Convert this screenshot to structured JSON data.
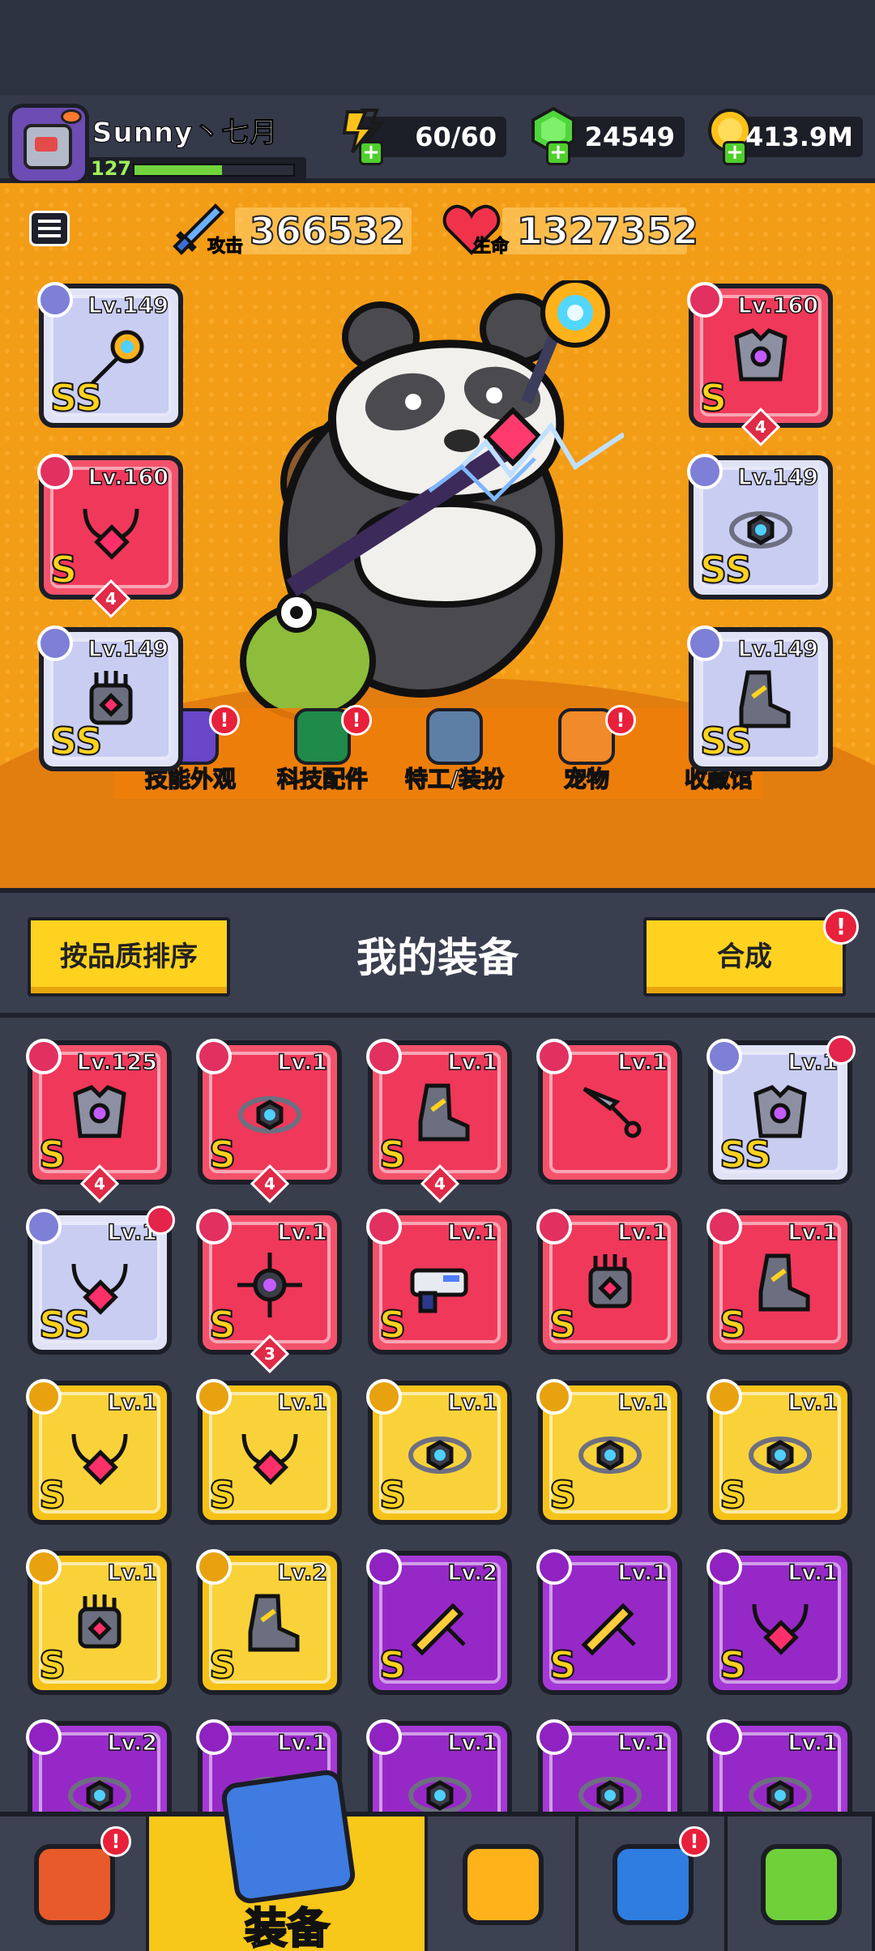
{
  "player": {
    "name": "Sunny丶七月",
    "level": "127",
    "xp_fraction": 0.55
  },
  "resources": {
    "energy": "60/60",
    "gems": "24549",
    "coins": "413.9M"
  },
  "stats": {
    "attack_value": "366532",
    "attack_label": "攻击",
    "hp_value": "1327352",
    "hp_label": "生命"
  },
  "equipped": {
    "left": [
      {
        "lv": "Lv.149",
        "color": "white",
        "rank": "SS",
        "icon": "staff-icon",
        "stars": ""
      },
      {
        "lv": "Lv.160",
        "color": "red",
        "rank": "S",
        "icon": "necklace-icon",
        "stars": "4"
      },
      {
        "lv": "Lv.149",
        "color": "white",
        "rank": "SS",
        "icon": "gauntlet-icon",
        "stars": ""
      }
    ],
    "right": [
      {
        "lv": "Lv.160",
        "color": "red",
        "rank": "S",
        "icon": "armor-icon",
        "stars": "4"
      },
      {
        "lv": "Lv.149",
        "color": "white",
        "rank": "SS",
        "icon": "belt-icon",
        "stars": ""
      },
      {
        "lv": "Lv.149",
        "color": "white",
        "rank": "SS",
        "icon": "boots-icon",
        "stars": ""
      }
    ]
  },
  "features": [
    {
      "label": "技能外观",
      "icon": "skill-skin-icon",
      "notif": "!"
    },
    {
      "label": "科技配件",
      "icon": "tech-parts-icon",
      "notif": "!"
    },
    {
      "label": "特工/装扮",
      "icon": "agent-costume-icon",
      "notif": ""
    },
    {
      "label": "宠物",
      "icon": "pet-icon",
      "notif": "!"
    },
    {
      "label": "收藏馆",
      "icon": "collection-icon",
      "notif": ""
    }
  ],
  "section": {
    "sort_label": "按品质排序",
    "title": "我的装备",
    "merge_label": "合成",
    "merge_notif": "!"
  },
  "inventory": [
    [
      {
        "lv": "Lv.125",
        "color": "red",
        "rank": "S",
        "icon": "armor-icon",
        "stars": "4",
        "shirt": false
      },
      {
        "lv": "Lv.1",
        "color": "red",
        "rank": "S",
        "icon": "belt-icon",
        "stars": "4",
        "shirt": false
      },
      {
        "lv": "Lv.1",
        "color": "red",
        "rank": "S",
        "icon": "boots-icon",
        "stars": "4",
        "shirt": false
      },
      {
        "lv": "Lv.1",
        "color": "red",
        "rank": "",
        "icon": "kunai-icon",
        "stars": "",
        "shirt": false
      },
      {
        "lv": "Lv.1",
        "color": "white",
        "rank": "SS",
        "icon": "armor-icon",
        "stars": "",
        "shirt": true
      }
    ],
    [
      {
        "lv": "Lv.1",
        "color": "white",
        "rank": "SS",
        "icon": "necklace-icon",
        "stars": "",
        "shirt": true
      },
      {
        "lv": "Lv.1",
        "color": "red",
        "rank": "S",
        "icon": "drill-icon",
        "stars": "3",
        "shirt": false
      },
      {
        "lv": "Lv.1",
        "color": "red",
        "rank": "S",
        "icon": "blaster-icon",
        "stars": "",
        "shirt": false
      },
      {
        "lv": "Lv.1",
        "color": "red",
        "rank": "S",
        "icon": "gauntlet-icon",
        "stars": "",
        "shirt": false
      },
      {
        "lv": "Lv.1",
        "color": "red",
        "rank": "S",
        "icon": "boots-icon",
        "stars": "",
        "shirt": false
      }
    ],
    [
      {
        "lv": "Lv.1",
        "color": "yellow",
        "rank": "S",
        "icon": "necklace-icon",
        "stars": "",
        "shirt": false
      },
      {
        "lv": "Lv.1",
        "color": "yellow",
        "rank": "S",
        "icon": "necklace-icon",
        "stars": "",
        "shirt": false
      },
      {
        "lv": "Lv.1",
        "color": "yellow",
        "rank": "S",
        "icon": "belt-icon",
        "stars": "",
        "shirt": false
      },
      {
        "lv": "Lv.1",
        "color": "yellow",
        "rank": "S",
        "icon": "belt-icon",
        "stars": "",
        "shirt": false
      },
      {
        "lv": "Lv.1",
        "color": "yellow",
        "rank": "S",
        "icon": "belt-icon",
        "stars": "",
        "shirt": false
      }
    ],
    [
      {
        "lv": "Lv.1",
        "color": "yellow",
        "rank": "S",
        "icon": "gauntlet-icon",
        "stars": "",
        "shirt": false
      },
      {
        "lv": "Lv.2",
        "color": "yellow",
        "rank": "S",
        "icon": "boots-icon",
        "stars": "",
        "shirt": false
      },
      {
        "lv": "Lv.2",
        "color": "purple",
        "rank": "S",
        "icon": "sword-icon",
        "stars": "",
        "shirt": false
      },
      {
        "lv": "Lv.1",
        "color": "purple",
        "rank": "S",
        "icon": "sword-icon",
        "stars": "",
        "shirt": false
      },
      {
        "lv": "Lv.1",
        "color": "purple",
        "rank": "S",
        "icon": "necklace-icon",
        "stars": "",
        "shirt": false
      }
    ],
    [
      {
        "lv": "Lv.2",
        "color": "purple",
        "rank": "",
        "icon": "belt-icon",
        "stars": "",
        "shirt": false
      },
      {
        "lv": "Lv.1",
        "color": "purple",
        "rank": "",
        "icon": "belt-icon",
        "stars": "",
        "shirt": false
      },
      {
        "lv": "Lv.1",
        "color": "purple",
        "rank": "",
        "icon": "belt-icon",
        "stars": "",
        "shirt": false
      },
      {
        "lv": "Lv.1",
        "color": "purple",
        "rank": "",
        "icon": "belt-icon",
        "stars": "",
        "shirt": false
      },
      {
        "lv": "Lv.1",
        "color": "purple",
        "rank": "",
        "icon": "belt-icon",
        "stars": "",
        "shirt": false
      }
    ]
  ],
  "bottom_nav": [
    {
      "label": "",
      "icon": "shop-icon",
      "notif": "!",
      "active": false
    },
    {
      "label": "装备",
      "icon": "equipment-icon",
      "notif": "",
      "active": true
    },
    {
      "label": "",
      "icon": "battle-icon",
      "notif": "",
      "active": false
    },
    {
      "label": "",
      "icon": "planet-icon",
      "notif": "!",
      "active": false
    },
    {
      "label": "",
      "icon": "evolve-icon",
      "notif": "",
      "active": false
    }
  ],
  "colors": {
    "red": "#f4526b",
    "white": "#dfe3f5",
    "yellow": "#f6c21a",
    "purple": "#a538d6",
    "hero_bg": "#f39c16",
    "panel": "#393e4d"
  }
}
